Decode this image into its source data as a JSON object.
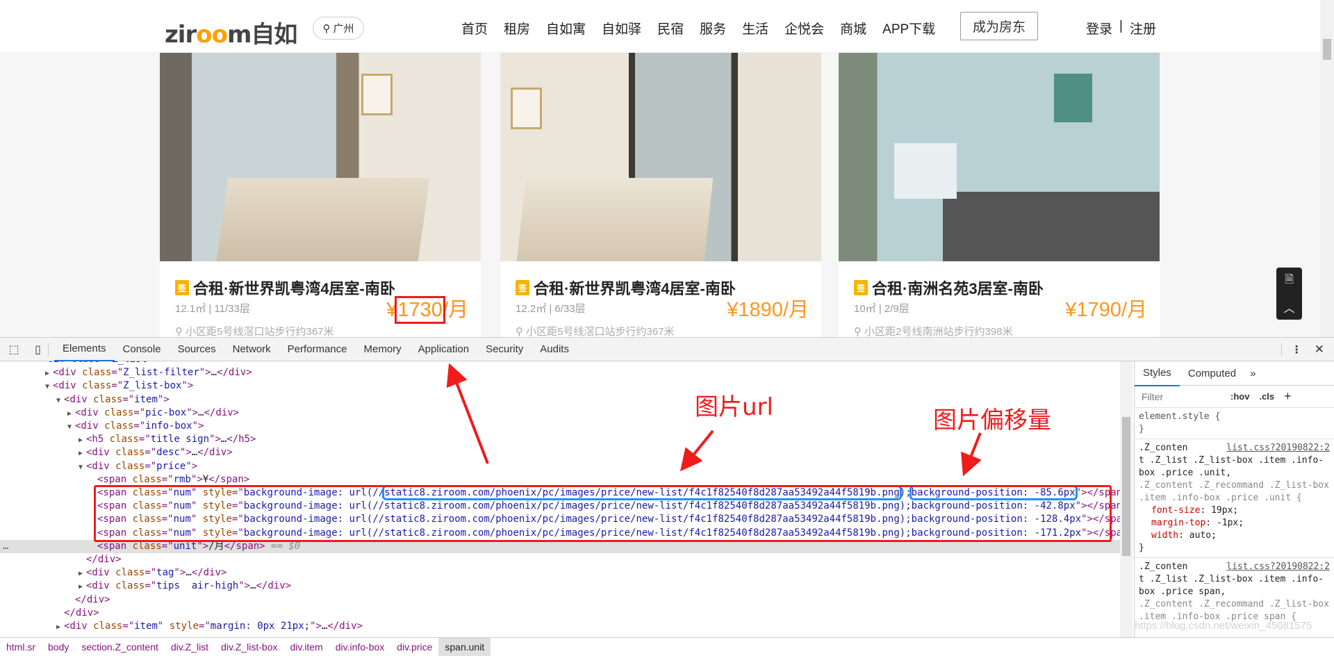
{
  "header": {
    "logo": "ziroom自如",
    "city": "广州",
    "nav": [
      "首页",
      "租房",
      "自如寓",
      "自如驿",
      "民宿",
      "服务",
      "生活",
      "企悦会",
      "商城",
      "APP下载"
    ],
    "become_landlord": "成为房东",
    "login": "登录",
    "sep": "|",
    "register": "注册"
  },
  "cards": [
    {
      "sign": "签",
      "title": "合租·新世界凯粤湾4居室-南卧",
      "meta": "12.1㎡ | 11/33层",
      "price": "¥1730/月",
      "price_num": "1730",
      "currency": "¥",
      "unit": "/月",
      "location": "小区距5号线滘口站步行约367米"
    },
    {
      "sign": "签",
      "title": "合租·新世界凯粤湾4居室-南卧",
      "meta": "12.2㎡ | 6/33层",
      "price": "¥1890/月",
      "location": "小区距5号线滘口站步行约367米"
    },
    {
      "sign": "签",
      "title": "合租·南洲名苑3居室-南卧",
      "meta": "10㎡ | 2/9层",
      "price": "¥1790/月",
      "location": "小区距2号线南洲站步行约398米"
    }
  ],
  "devtools": {
    "tabs": [
      "Elements",
      "Console",
      "Sources",
      "Network",
      "Performance",
      "Memory",
      "Application",
      "Security",
      "Audits"
    ],
    "active_tab": "Elements",
    "dom_lines": [
      {
        "indent": 3,
        "toggle": "",
        "tokens": [
          [
            "tg",
            "<div "
          ],
          [
            "an",
            "class"
          ],
          [
            "tg",
            "=\""
          ],
          [
            "av",
            "Z_list"
          ],
          [
            "tg",
            "\">"
          ]
        ]
      },
      {
        "indent": 4,
        "toggle": "closed",
        "tokens": [
          [
            "tg",
            "<div "
          ],
          [
            "an",
            "class"
          ],
          [
            "tg",
            "=\""
          ],
          [
            "av",
            "Z_list-filter"
          ],
          [
            "tg",
            "\">"
          ],
          [
            "tx",
            "…"
          ],
          [
            "tg",
            "</div>"
          ]
        ]
      },
      {
        "indent": 4,
        "toggle": "open",
        "tokens": [
          [
            "tg",
            "<div "
          ],
          [
            "an",
            "class"
          ],
          [
            "tg",
            "=\""
          ],
          [
            "av",
            "Z_list-box"
          ],
          [
            "tg",
            "\">"
          ]
        ]
      },
      {
        "indent": 5,
        "toggle": "open",
        "tokens": [
          [
            "tg",
            "<div "
          ],
          [
            "an",
            "class"
          ],
          [
            "tg",
            "=\""
          ],
          [
            "av",
            "item"
          ],
          [
            "tg",
            "\">"
          ]
        ]
      },
      {
        "indent": 6,
        "toggle": "closed",
        "tokens": [
          [
            "tg",
            "<div "
          ],
          [
            "an",
            "class"
          ],
          [
            "tg",
            "=\""
          ],
          [
            "av",
            "pic-box"
          ],
          [
            "tg",
            "\">"
          ],
          [
            "tx",
            "…"
          ],
          [
            "tg",
            "</div>"
          ]
        ]
      },
      {
        "indent": 6,
        "toggle": "open",
        "tokens": [
          [
            "tg",
            "<div "
          ],
          [
            "an",
            "class"
          ],
          [
            "tg",
            "=\""
          ],
          [
            "av",
            "info-box"
          ],
          [
            "tg",
            "\">"
          ]
        ]
      },
      {
        "indent": 7,
        "toggle": "closed",
        "tokens": [
          [
            "tg",
            "<h5 "
          ],
          [
            "an",
            "class"
          ],
          [
            "tg",
            "=\""
          ],
          [
            "av",
            "title sign"
          ],
          [
            "tg",
            "\">"
          ],
          [
            "tx",
            "…"
          ],
          [
            "tg",
            "</h5>"
          ]
        ]
      },
      {
        "indent": 7,
        "toggle": "closed",
        "tokens": [
          [
            "tg",
            "<div "
          ],
          [
            "an",
            "class"
          ],
          [
            "tg",
            "=\""
          ],
          [
            "av",
            "desc"
          ],
          [
            "tg",
            "\">"
          ],
          [
            "tx",
            "…"
          ],
          [
            "tg",
            "</div>"
          ]
        ]
      },
      {
        "indent": 7,
        "toggle": "open",
        "tokens": [
          [
            "tg",
            "<div "
          ],
          [
            "an",
            "class"
          ],
          [
            "tg",
            "=\""
          ],
          [
            "av",
            "price"
          ],
          [
            "tg",
            "\">"
          ]
        ]
      },
      {
        "indent": 8,
        "toggle": "",
        "tokens": [
          [
            "tg",
            "<span "
          ],
          [
            "an",
            "class"
          ],
          [
            "tg",
            "=\""
          ],
          [
            "av",
            "rmb"
          ],
          [
            "tg",
            "\">"
          ],
          [
            "tx",
            "¥"
          ],
          [
            "tg",
            "</span>"
          ]
        ]
      },
      {
        "indent": 8,
        "toggle": "",
        "tokens": [
          [
            "tg",
            "<span "
          ],
          [
            "an",
            "class"
          ],
          [
            "tg",
            "=\""
          ],
          [
            "av",
            "num"
          ],
          [
            "tg",
            "\" "
          ],
          [
            "an",
            "style"
          ],
          [
            "tg",
            "=\""
          ],
          [
            "av",
            "background-image: url(//"
          ],
          [
            "avu",
            "static8.ziroom.com/phoenix/pc/images/price/new-list/f4c1f82540f8d287aa53492a44f5819b.png"
          ],
          [
            "av",
            ");"
          ],
          [
            "avp",
            "background-position: -85.6px"
          ],
          [
            "tg",
            "\"></span>"
          ]
        ]
      },
      {
        "indent": 8,
        "toggle": "",
        "tokens": [
          [
            "tg",
            "<span "
          ],
          [
            "an",
            "class"
          ],
          [
            "tg",
            "=\""
          ],
          [
            "av",
            "num"
          ],
          [
            "tg",
            "\" "
          ],
          [
            "an",
            "style"
          ],
          [
            "tg",
            "=\""
          ],
          [
            "av",
            "background-image: url(//static8.ziroom.com/phoenix/pc/images/price/new-list/f4c1f82540f8d287aa53492a44f5819b.png);background-position: -42.8px"
          ],
          [
            "tg",
            "\"></span>"
          ]
        ]
      },
      {
        "indent": 8,
        "toggle": "",
        "tokens": [
          [
            "tg",
            "<span "
          ],
          [
            "an",
            "class"
          ],
          [
            "tg",
            "=\""
          ],
          [
            "av",
            "num"
          ],
          [
            "tg",
            "\" "
          ],
          [
            "an",
            "style"
          ],
          [
            "tg",
            "=\""
          ],
          [
            "av",
            "background-image: url(//static8.ziroom.com/phoenix/pc/images/price/new-list/f4c1f82540f8d287aa53492a44f5819b.png);background-position: -128.4px"
          ],
          [
            "tg",
            "\"></span>"
          ]
        ]
      },
      {
        "indent": 8,
        "toggle": "",
        "tokens": [
          [
            "tg",
            "<span "
          ],
          [
            "an",
            "class"
          ],
          [
            "tg",
            "=\""
          ],
          [
            "av",
            "num"
          ],
          [
            "tg",
            "\" "
          ],
          [
            "an",
            "style"
          ],
          [
            "tg",
            "=\""
          ],
          [
            "av",
            "background-image: url(//static8.ziroom.com/phoenix/pc/images/price/new-list/f4c1f82540f8d287aa53492a44f5819b.png);background-position: -171.2px"
          ],
          [
            "tg",
            "\"></span>"
          ]
        ]
      },
      {
        "indent": 8,
        "toggle": "",
        "selected": true,
        "tokens": [
          [
            "tg",
            "<span "
          ],
          [
            "an",
            "class"
          ],
          [
            "tg",
            "=\""
          ],
          [
            "av",
            "unit"
          ],
          [
            "tg",
            "\">"
          ],
          [
            "tx",
            "/月"
          ],
          [
            "tg",
            "</span>"
          ],
          [
            "cm",
            " == $0"
          ]
        ]
      },
      {
        "indent": 7,
        "toggle": "",
        "tokens": [
          [
            "tg",
            "</div>"
          ]
        ]
      },
      {
        "indent": 7,
        "toggle": "closed",
        "tokens": [
          [
            "tg",
            "<div "
          ],
          [
            "an",
            "class"
          ],
          [
            "tg",
            "=\""
          ],
          [
            "av",
            "tag"
          ],
          [
            "tg",
            "\">"
          ],
          [
            "tx",
            "…"
          ],
          [
            "tg",
            "</div>"
          ]
        ]
      },
      {
        "indent": 7,
        "toggle": "closed",
        "tokens": [
          [
            "tg",
            "<div "
          ],
          [
            "an",
            "class"
          ],
          [
            "tg",
            "=\""
          ],
          [
            "av",
            "tips  air-high"
          ],
          [
            "tg",
            "\">"
          ],
          [
            "tx",
            "…"
          ],
          [
            "tg",
            "</div>"
          ]
        ]
      },
      {
        "indent": 6,
        "toggle": "",
        "tokens": [
          [
            "tg",
            "</div>"
          ]
        ]
      },
      {
        "indent": 5,
        "toggle": "",
        "tokens": [
          [
            "tg",
            "</div>"
          ]
        ]
      },
      {
        "indent": 5,
        "toggle": "closed",
        "tokens": [
          [
            "tg",
            "<div "
          ],
          [
            "an",
            "class"
          ],
          [
            "tg",
            "=\""
          ],
          [
            "av",
            "item"
          ],
          [
            "tg",
            "\" "
          ],
          [
            "an",
            "style"
          ],
          [
            "tg",
            "=\""
          ],
          [
            "av",
            "margin: 0px 21px;"
          ],
          [
            "tg",
            "\">"
          ],
          [
            "tx",
            "…"
          ],
          [
            "tg",
            "</div>"
          ]
        ]
      }
    ],
    "selected_marker": "…",
    "styles": {
      "tabs": [
        "Styles",
        "Computed",
        "»"
      ],
      "filter_placeholder": "Filter",
      "hov": ":hov",
      "cls": ".cls",
      "plus": "+",
      "element_style": "element.style {",
      "close": "}",
      "rule1_source": "list.css?20190822:2",
      "rule1_selector_a": ".Z_conten",
      "rule1_selector_b": "t .Z_list .Z_list-box .item .info-box .price .unit,",
      "rule1_selector_c": ".Z_content .Z_recommand .Z_list-box .item .info-box .price .unit {",
      "rule1_props": [
        [
          "font-size",
          "19px;"
        ],
        [
          "margin-top",
          "-1px;"
        ],
        [
          "width",
          "auto;"
        ]
      ],
      "rule2_source": "list.css?20190822:2",
      "rule2_selector_a": ".Z_conten",
      "rule2_selector_b": "t .Z_list .Z_list-box .item .info-box .price span,",
      "rule2_selector_c": ".Z_content .Z_recommand .Z_list-box .item .info-box .price span {"
    },
    "breadcrumbs": [
      "html.sr",
      "body",
      "section.Z_content",
      "div.Z_list",
      "div.Z_list-box",
      "div.item",
      "div.info-box",
      "div.price",
      "span.unit"
    ]
  },
  "annotations": {
    "url_label": "图片url",
    "offset_label": "图片偏移量",
    "watermark": "https://blog.csdn.net/weixin_45081575"
  },
  "colors": {
    "price": "#ff961e",
    "annotation": "#f21a1a",
    "highlight_box": "#1e90ff"
  }
}
